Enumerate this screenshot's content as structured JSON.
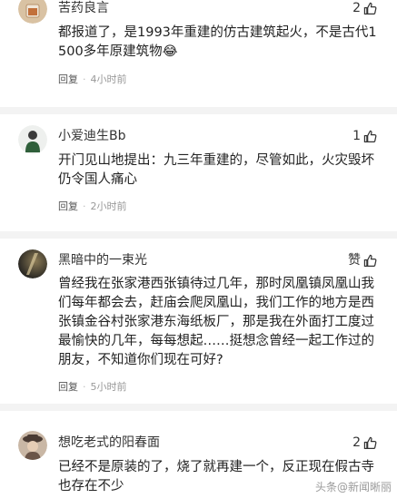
{
  "comments": [
    {
      "username": "苦药良言",
      "likes": "2",
      "text": "都报道了，是1993年重建的仿古建筑起火，不是古代1500多年原建筑物😂",
      "reply_label": "回复",
      "time": "4小时前"
    },
    {
      "username": "小爱迪生Bb",
      "likes": "1",
      "text": "开门见山地提出：九三年重建的，尽管如此，火灾毁坏仍令国人痛心",
      "reply_label": "回复",
      "time": "2小时前"
    },
    {
      "username": "黑暗中的一束光",
      "likes": "赞",
      "text": "曾经我在张家港西张镇待过几年，那时凤凰镇凤凰山我们每年都会去，赶庙会爬凤凰山，我们工作的地方是西张镇金谷村张家港东海纸板厂，那是我在外面打工度过最愉快的几年，每每想起……挺想念曾经一起工作过的朋友，不知道你们现在可好?",
      "reply_label": "回复",
      "time": "5小时前"
    },
    {
      "username": "想吃老式的阳春面",
      "likes": "2",
      "text": "已经不是原装的了，烧了就再建一个，反正现在假古寺也存在不少",
      "reply_label": "",
      "time": ""
    }
  ],
  "icons": {
    "like": "thumbs-up-icon"
  },
  "colors": {
    "text": "#222222",
    "meta": "#999999",
    "divider": "#f3f3f3"
  },
  "watermark": "头条@新闻晰丽"
}
